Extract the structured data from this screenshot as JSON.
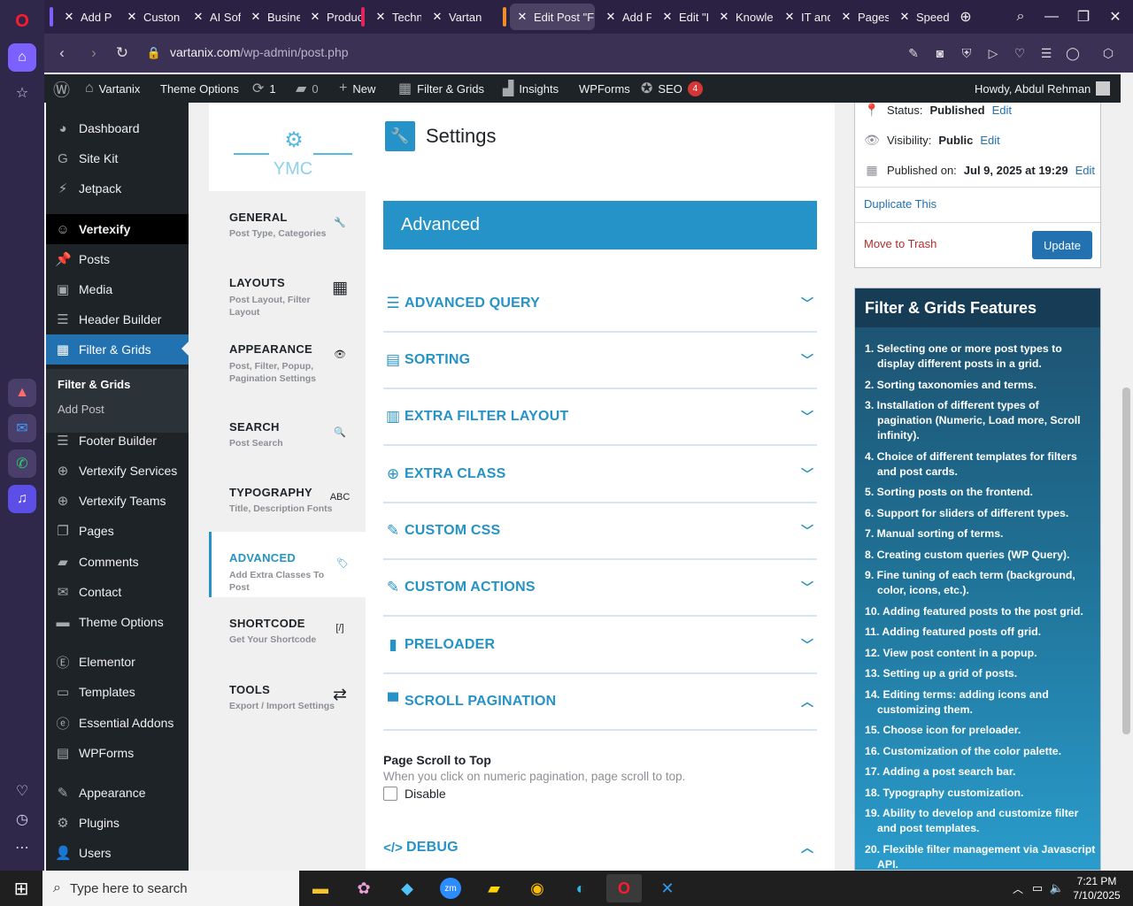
{
  "tabs": [
    {
      "label": "Add P",
      "accent": "#7b61ff"
    },
    {
      "label": "Custon"
    },
    {
      "label": "AI Soft"
    },
    {
      "label": "Busine"
    },
    {
      "label": "Produc"
    },
    {
      "label": "Techno",
      "accent": "#e0245e"
    },
    {
      "label": "Vartan"
    },
    {
      "label": "Edit Post \"Fil",
      "accent": "#f28c28",
      "active": true
    },
    {
      "label": "Add Po"
    },
    {
      "label": "Edit \"K"
    },
    {
      "label": "Knowle"
    },
    {
      "label": "IT and"
    },
    {
      "label": "Pages"
    },
    {
      "label": "Speed"
    }
  ],
  "address": {
    "domain": "vartanix.com",
    "path": "/wp-admin/post.php"
  },
  "adminbar": {
    "site": "Vartanix",
    "theme_options": "Theme Options",
    "updates": "1",
    "comments": "0",
    "new": "New",
    "filter_grids": "Filter & Grids",
    "insights": "Insights",
    "wpforms": "WPForms",
    "seo": "SEO",
    "seo_count": "4",
    "howdy": "Howdy, Abdul Rehman"
  },
  "sidebar": {
    "items": [
      {
        "label": "Dashboard",
        "icon": "dashboard-icon",
        "glyph": "◕"
      },
      {
        "label": "Site Kit",
        "icon": "sitekit-icon",
        "glyph": "G"
      },
      {
        "label": "Jetpack",
        "icon": "jetpack-icon",
        "glyph": "⚡"
      },
      {
        "label": "Vertexify",
        "icon": "smile-icon",
        "glyph": "☺"
      },
      {
        "label": "Posts",
        "icon": "pin-icon",
        "glyph": "📌"
      },
      {
        "label": "Media",
        "icon": "media-icon",
        "glyph": "▣"
      },
      {
        "label": "Header Builder",
        "icon": "header-builder-icon",
        "glyph": "☰"
      },
      {
        "label": "Filter & Grids",
        "icon": "grid-icon",
        "glyph": "▦"
      },
      {
        "label": "Footer Builder",
        "icon": "footer-builder-icon",
        "glyph": "☰"
      },
      {
        "label": "Vertexify Services",
        "icon": "plus-circle-icon",
        "glyph": "⊕"
      },
      {
        "label": "Vertexify Teams",
        "icon": "plus-circle-icon",
        "glyph": "⊕"
      },
      {
        "label": "Pages",
        "icon": "pages-icon",
        "glyph": "❐"
      },
      {
        "label": "Comments",
        "icon": "comments-icon",
        "glyph": "▰"
      },
      {
        "label": "Contact",
        "icon": "mail-icon",
        "glyph": "✉"
      },
      {
        "label": "Theme Options",
        "icon": "folder-icon",
        "glyph": "▬"
      },
      {
        "label": "Elementor",
        "icon": "elementor-icon",
        "glyph": "Ⓔ"
      },
      {
        "label": "Templates",
        "icon": "templates-icon",
        "glyph": "▭"
      },
      {
        "label": "Essential Addons",
        "icon": "ea-icon",
        "glyph": "ⓔ"
      },
      {
        "label": "WPForms",
        "icon": "wpforms-icon",
        "glyph": "▤"
      },
      {
        "label": "Appearance",
        "icon": "brush-icon",
        "glyph": "✎"
      },
      {
        "label": "Plugins",
        "icon": "plugin-icon",
        "glyph": "⚙"
      },
      {
        "label": "Users",
        "icon": "user-icon",
        "glyph": "👤"
      }
    ],
    "submenu": [
      "Filter & Grids",
      "Add Post"
    ]
  },
  "ymc": {
    "logo_text": "YMC",
    "tabs": [
      {
        "title": "GENERAL",
        "sub": "Post Type, Categories",
        "icon": "wrench-icon",
        "glyph": "🔧"
      },
      {
        "title": "LAYOUTS",
        "sub": "Post Layout, Filter Layout",
        "icon": "layout-icon",
        "glyph": "▦"
      },
      {
        "title": "APPEARANCE",
        "sub": "Post, Filter, Popup, Pagination Settings",
        "icon": "eye-icon",
        "glyph": "👁"
      },
      {
        "title": "SEARCH",
        "sub": "Post Search",
        "icon": "search-icon",
        "glyph": "🔍"
      },
      {
        "title": "TYPOGRAPHY",
        "sub": "Title, Description Fonts",
        "icon": "typography-icon",
        "glyph": "ABC"
      },
      {
        "title": "ADVANCED",
        "sub": "Add Extra Classes To Post",
        "icon": "tag-icon",
        "glyph": "🏷",
        "active": true
      },
      {
        "title": "SHORTCODE",
        "sub": "Get Your Shortcode",
        "icon": "shortcode-icon",
        "glyph": "[/]"
      },
      {
        "title": "TOOLS",
        "sub": "Export / Import Settings",
        "icon": "exchange-icon",
        "glyph": "⇄"
      }
    ]
  },
  "settings": {
    "title": "Settings",
    "banner": "Advanced",
    "sections": [
      {
        "label": "ADVANCED QUERY",
        "icon": "database-icon",
        "glyph": "☰",
        "open": false
      },
      {
        "label": "SORTING",
        "icon": "sorting-icon",
        "glyph": "▤",
        "open": false
      },
      {
        "label": "EXTRA FILTER LAYOUT",
        "icon": "filter-layout-icon",
        "glyph": "▥",
        "open": false
      },
      {
        "label": "EXTRA CLASS",
        "icon": "plus-circle-icon",
        "glyph": "⊕",
        "open": false
      },
      {
        "label": "CUSTOM CSS",
        "icon": "edit-icon",
        "glyph": "✎",
        "open": false
      },
      {
        "label": "CUSTOM ACTIONS",
        "icon": "edit-icon",
        "glyph": "✎",
        "open": false
      },
      {
        "label": "PRELOADER",
        "icon": "preloader-icon",
        "glyph": "▮",
        "open": false
      },
      {
        "label": "SCROLL PAGINATION",
        "icon": "pagination-icon",
        "glyph": "▀",
        "open": true
      }
    ],
    "page_scroll": {
      "title": "Page Scroll to Top",
      "desc": "When you click on numeric pagination, page scroll to top.",
      "checkbox": "Disable"
    },
    "debug": "DEBUG"
  },
  "publish": {
    "status_label": "Status:",
    "status_value": "Published",
    "visibility_label": "Visibility:",
    "visibility_value": "Public",
    "published_label": "Published on:",
    "published_value": "Jul 9, 2025 at 19:29",
    "edit": "Edit",
    "duplicate": "Duplicate This",
    "trash": "Move to Trash",
    "update": "Update"
  },
  "features": {
    "title": "Filter & Grids Features",
    "items": [
      "1. Selecting one or more post types to display different posts in a grid.",
      "2. Sorting taxonomies and terms.",
      "3. Installation of different types of pagination (Numeric, Load more, Scroll infinity).",
      "4. Choice of different templates for filters and post cards.",
      "5. Sorting posts on the frontend.",
      "6. Support for sliders of different types.",
      "7. Manual sorting of terms.",
      "8. Creating custom queries (WP Query).",
      "9. Fine tuning of each term (background, color, icons, etc.).",
      "10. Adding featured posts to the post grid.",
      "11. Adding featured posts off grid.",
      "12. View post content in a popup.",
      "13. Setting up a grid of posts.",
      "14. Editing terms: adding icons and customizing them.",
      "15. Choose icon for preloader.",
      "16. Customization of the color palette.",
      "17. Adding a post search bar.",
      "18. Typography customization.",
      "19. Ability to develop and customize filter and post templates.",
      "20. Flexible filter management via Javascript API."
    ]
  },
  "taskbar": {
    "search_placeholder": "Type here to search",
    "time": "7:21 PM",
    "date": "7/10/2025"
  },
  "colors": {
    "accent": "#2593c7",
    "wp_blue": "#2271b1",
    "admin_dark": "#1d2327"
  }
}
